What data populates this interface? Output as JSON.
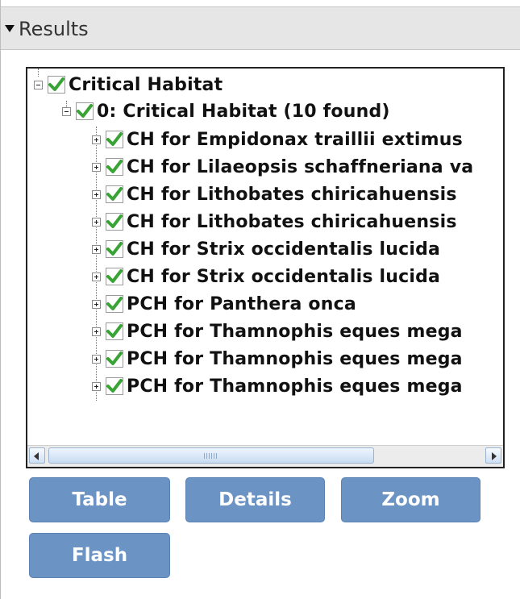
{
  "panel": {
    "title": "Results"
  },
  "tree": {
    "root": {
      "label": "Critical Habitat"
    },
    "layer": {
      "label": "0: Critical Habitat (10 found)"
    },
    "items": [
      {
        "label": "CH for Empidonax traillii extimus"
      },
      {
        "label": "CH for Lilaeopsis schaffneriana va"
      },
      {
        "label": "CH for Lithobates chiricahuensis"
      },
      {
        "label": "CH for Lithobates chiricahuensis"
      },
      {
        "label": "CH for Strix occidentalis lucida"
      },
      {
        "label": "CH for Strix occidentalis lucida"
      },
      {
        "label": "PCH for Panthera onca"
      },
      {
        "label": "PCH for Thamnophis eques mega"
      },
      {
        "label": "PCH for Thamnophis eques mega"
      },
      {
        "label": "PCH for Thamnophis eques mega"
      }
    ]
  },
  "scrollbar": {
    "grip": "III"
  },
  "buttons": {
    "table": "Table",
    "details": "Details",
    "zoom": "Zoom",
    "flash": "Flash"
  },
  "colors": {
    "accent": "#6b93c4",
    "check": "#3aa335"
  }
}
